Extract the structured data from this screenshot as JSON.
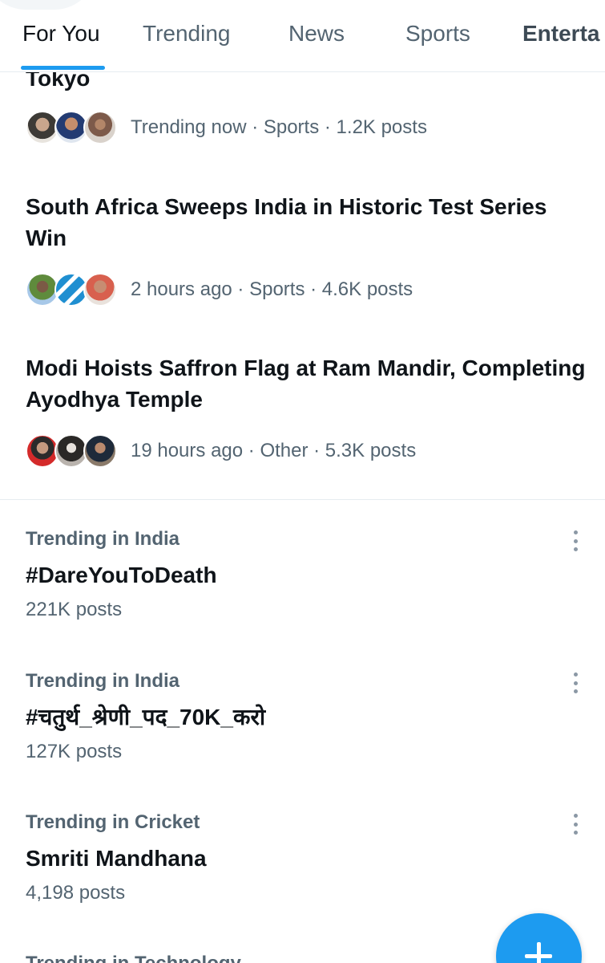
{
  "tabs": [
    "For You",
    "Trending",
    "News",
    "Sports",
    "Enterta"
  ],
  "topics": [
    {
      "title": "Tokyo",
      "meta": "Trending now · Sports · 1.2K posts"
    },
    {
      "title": "South Africa Sweeps India in Historic Test Series Win",
      "meta": "2 hours ago · Sports · 4.6K posts"
    },
    {
      "title": "Modi Hoists Saffron Flag at Ram Mandir, Completing Ayodhya Temple",
      "meta": "19 hours ago · Other · 5.3K posts"
    }
  ],
  "trends": [
    {
      "context": "Trending in India",
      "name": "#DareYouToDeath",
      "count": "221K posts"
    },
    {
      "context": "Trending in India",
      "name": "#चतुर्थ_श्रेणी_पद_70K_करो",
      "count": "127K posts"
    },
    {
      "context": "Trending in Cricket",
      "name": "Smriti Mandhana",
      "count": "4,198 posts"
    },
    {
      "context": "Trending in Technology"
    }
  ],
  "colors": {
    "accent": "#1d9bf0",
    "text_primary": "#0f1419",
    "text_secondary": "#536471",
    "divider": "#e6ecf0"
  },
  "icons": {
    "more": "more-vertical-icon",
    "compose": "plus-icon"
  }
}
